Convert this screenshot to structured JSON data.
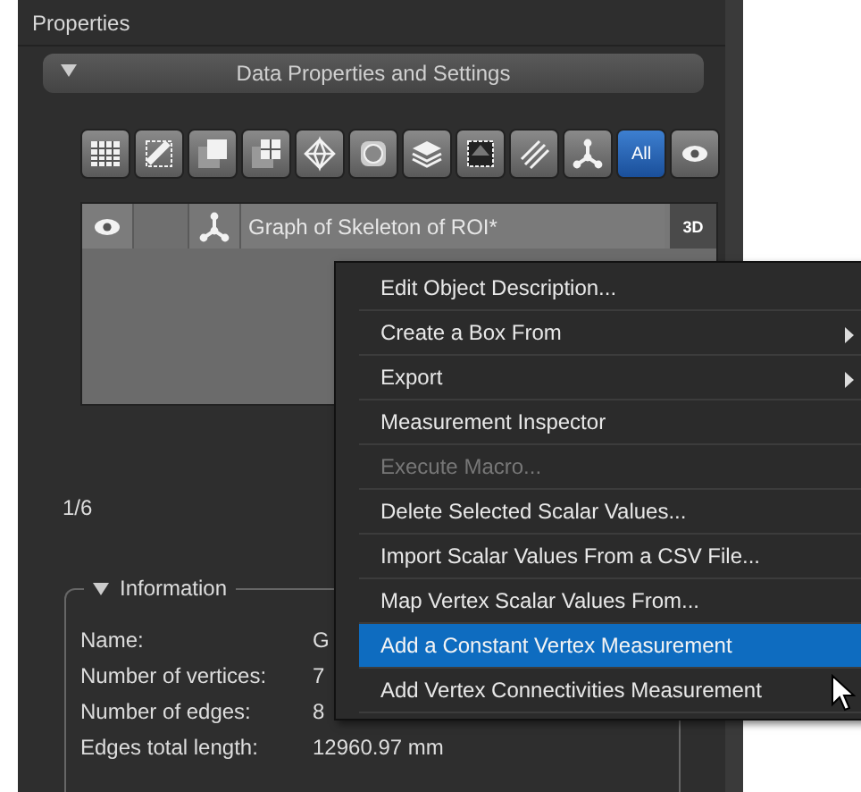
{
  "panel": {
    "title": "Properties"
  },
  "section": {
    "title": "Data Properties and Settings",
    "expanded": true
  },
  "filters": [
    {
      "kind": "table",
      "selected": false
    },
    {
      "kind": "ruler",
      "selected": false
    },
    {
      "kind": "square",
      "selected": false
    },
    {
      "kind": "grid",
      "selected": false
    },
    {
      "kind": "diamond",
      "selected": false
    },
    {
      "kind": "sphere",
      "selected": false
    },
    {
      "kind": "layers",
      "selected": false
    },
    {
      "kind": "frame",
      "selected": false
    },
    {
      "kind": "lines",
      "selected": false
    },
    {
      "kind": "skeleton",
      "selected": false
    },
    {
      "kind": "text",
      "label": "All",
      "selected": true
    },
    {
      "kind": "eye",
      "selected": false
    }
  ],
  "objects": [
    {
      "name": "Graph of Skeleton of ROI*",
      "badge": "3D"
    }
  ],
  "page_counter": "1/6",
  "information": {
    "title": "Information",
    "expanded": true,
    "rows": [
      {
        "label": "Name:",
        "value": "G"
      },
      {
        "label": "Number of vertices:",
        "value": "7"
      },
      {
        "label": "Number of edges:",
        "value": "8"
      },
      {
        "label": "Edges total length:",
        "value": "12960.97 mm"
      }
    ]
  },
  "context_menu": {
    "items": [
      {
        "label": "Edit Object Description...",
        "submenu": false,
        "disabled": false,
        "selected": false
      },
      {
        "label": "Create a Box From",
        "submenu": true,
        "disabled": false,
        "selected": false
      },
      {
        "label": "Export",
        "submenu": true,
        "disabled": false,
        "selected": false
      },
      {
        "label": "Measurement Inspector",
        "submenu": false,
        "disabled": false,
        "selected": false
      },
      {
        "label": "Execute Macro...",
        "submenu": false,
        "disabled": true,
        "selected": false
      },
      {
        "label": "Delete Selected Scalar Values...",
        "submenu": false,
        "disabled": false,
        "selected": false
      },
      {
        "label": "Import Scalar Values From a CSV File...",
        "submenu": false,
        "disabled": false,
        "selected": false
      },
      {
        "label": "Map Vertex Scalar Values From...",
        "submenu": false,
        "disabled": false,
        "selected": false
      },
      {
        "label": "Add a Constant Vertex Measurement",
        "submenu": false,
        "disabled": false,
        "selected": true
      },
      {
        "label": "Add Vertex Connectivities Measurement",
        "submenu": false,
        "disabled": false,
        "selected": false
      }
    ]
  }
}
